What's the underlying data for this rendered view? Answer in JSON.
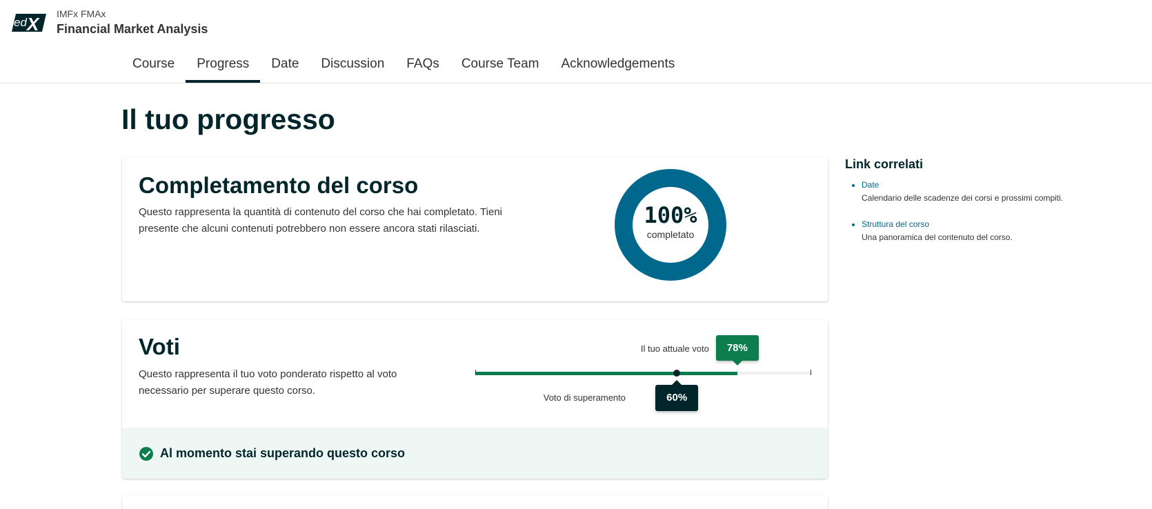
{
  "header": {
    "logo_text": "edX",
    "course_org": "IMFx FMAx",
    "course_title": "Financial Market Analysis"
  },
  "tabs": [
    {
      "label": "Course",
      "active": false
    },
    {
      "label": "Progress",
      "active": true
    },
    {
      "label": "Date",
      "active": false
    },
    {
      "label": "Discussion",
      "active": false
    },
    {
      "label": "FAQs",
      "active": false
    },
    {
      "label": "Course Team",
      "active": false
    },
    {
      "label": "Acknowledgements",
      "active": false
    }
  ],
  "page_title": "Il tuo progresso",
  "completion": {
    "title": "Completamento del corso",
    "description": "Questo rappresenta la quantità di contenuto del corso che hai completato. Tieni presente che alcuni contenuti potrebbero non essere ancora stati rilasciati.",
    "percent_label": "100%",
    "percent_value": 100,
    "caption": "completato",
    "ring_color": "#00688d"
  },
  "grades": {
    "title": "Voti",
    "description": "Questo rappresenta il tuo voto ponderato rispetto al voto necessario per superare questo corso.",
    "current_label": "Il tuo attuale voto",
    "current_value_label": "78%",
    "current_value": 78,
    "passing_label": "Voto di superamento",
    "passing_value_label": "60%",
    "passing_value": 60,
    "status_text": "Al momento stai superando questo corso",
    "success_color": "#0d7d4d"
  },
  "sidebar": {
    "title": "Link correlati",
    "links": [
      {
        "label": "Date",
        "description": "Calendario delle scadenze dei corsi e prossimi compiti."
      },
      {
        "label": "Struttura del corso",
        "description": "Una panoramica del contenuto del corso."
      }
    ]
  },
  "icons": {
    "status": "check-circle-icon",
    "logo": "edx-logo"
  }
}
